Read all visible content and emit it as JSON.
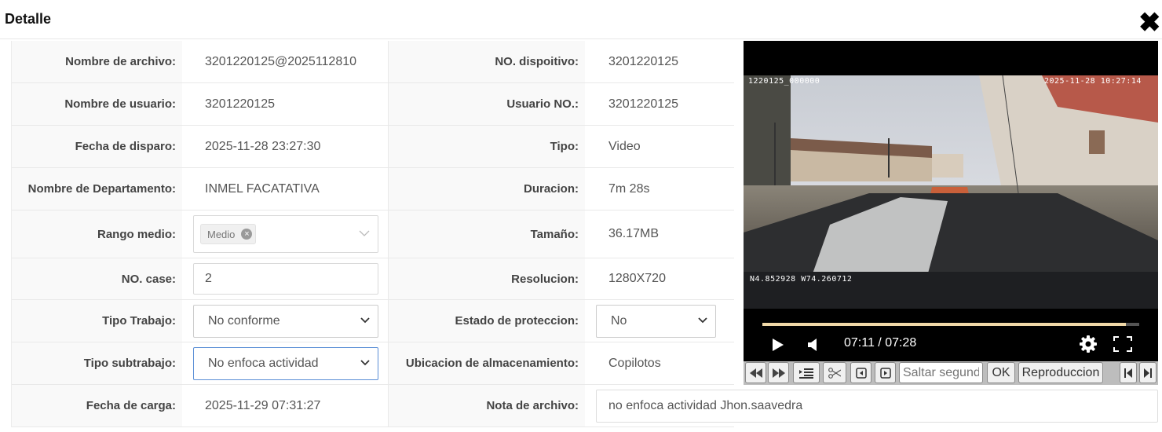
{
  "header": {
    "title": "Detalle",
    "close_glyph": "✖"
  },
  "form": {
    "file_name": {
      "label": "Nombre de archivo:",
      "value": "3201220125@2025112810"
    },
    "device_no": {
      "label": "NO. dispoitivo:",
      "value": "3201220125"
    },
    "user_name": {
      "label": "Nombre de usuario:",
      "value": "3201220125"
    },
    "user_no": {
      "label": "Usuario NO.:",
      "value": "3201220125"
    },
    "shot_date": {
      "label": "Fecha de disparo:",
      "value": "2025-11-28 23:27:30"
    },
    "type": {
      "label": "Tipo:",
      "value": "Video"
    },
    "department": {
      "label": "Nombre de Departamento:",
      "value": "INMEL FACATATIVA"
    },
    "duration": {
      "label": "Duracion:",
      "value": "7m 28s"
    },
    "range": {
      "label": "Rango medio:",
      "tag": "Medio"
    },
    "size": {
      "label": "Tamaño:",
      "value": "36.17MB"
    },
    "case_no": {
      "label": "NO. case:",
      "value": "2"
    },
    "resolution": {
      "label": "Resolucion:",
      "value": "1280X720"
    },
    "work_type": {
      "label": "Tipo Trabajo:",
      "selected": "No conforme"
    },
    "protection": {
      "label": "Estado de proteccion:",
      "selected": "No"
    },
    "work_subtype": {
      "label": "Tipo subtrabajo:",
      "selected": "No enfoca actividad"
    },
    "storage": {
      "label": "Ubicacion de almacenamiento:",
      "value": "Copilotos"
    },
    "upload_date": {
      "label": "Fecha de carga:",
      "value": "2025-11-29 07:31:27"
    },
    "file_note": {
      "label": "Nota de archivo:",
      "value": "no enfoca actividad Jhon.saavedra"
    }
  },
  "video": {
    "osd_id": "1220125_000000",
    "osd_datetime": "2025-11-28 10:27:14",
    "osd_gps": "N4.852928 W74.260712",
    "time": "07:11 / 07:28",
    "progress": 0.965
  },
  "toolbar": {
    "seek_placeholder": "Saltar segundo",
    "ok": "OK",
    "playback": "Reproduccion"
  }
}
